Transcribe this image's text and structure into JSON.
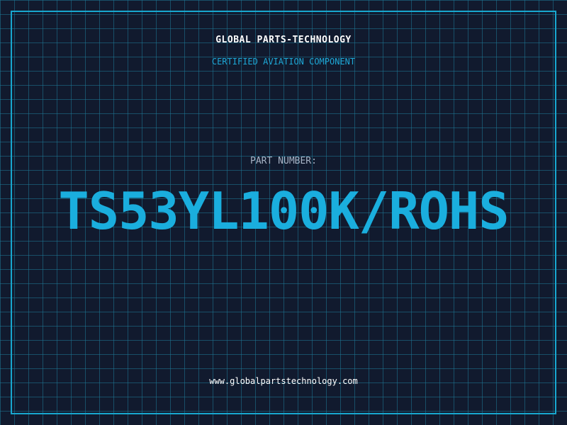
{
  "header": {
    "company": "GLOBAL PARTS-TECHNOLOGY",
    "tagline": "CERTIFIED AVIATION COMPONENT"
  },
  "part": {
    "label": "PART NUMBER:",
    "number": "TS53YL100K/ROHS"
  },
  "footer": {
    "website": "www.globalpartstechnology.com"
  },
  "colors": {
    "background": "#111a2e",
    "grid": "#1e7896",
    "frame": "#18a7cf",
    "accent": "#1aaede",
    "label": "#a7b4c6",
    "text": "#ffffff"
  }
}
